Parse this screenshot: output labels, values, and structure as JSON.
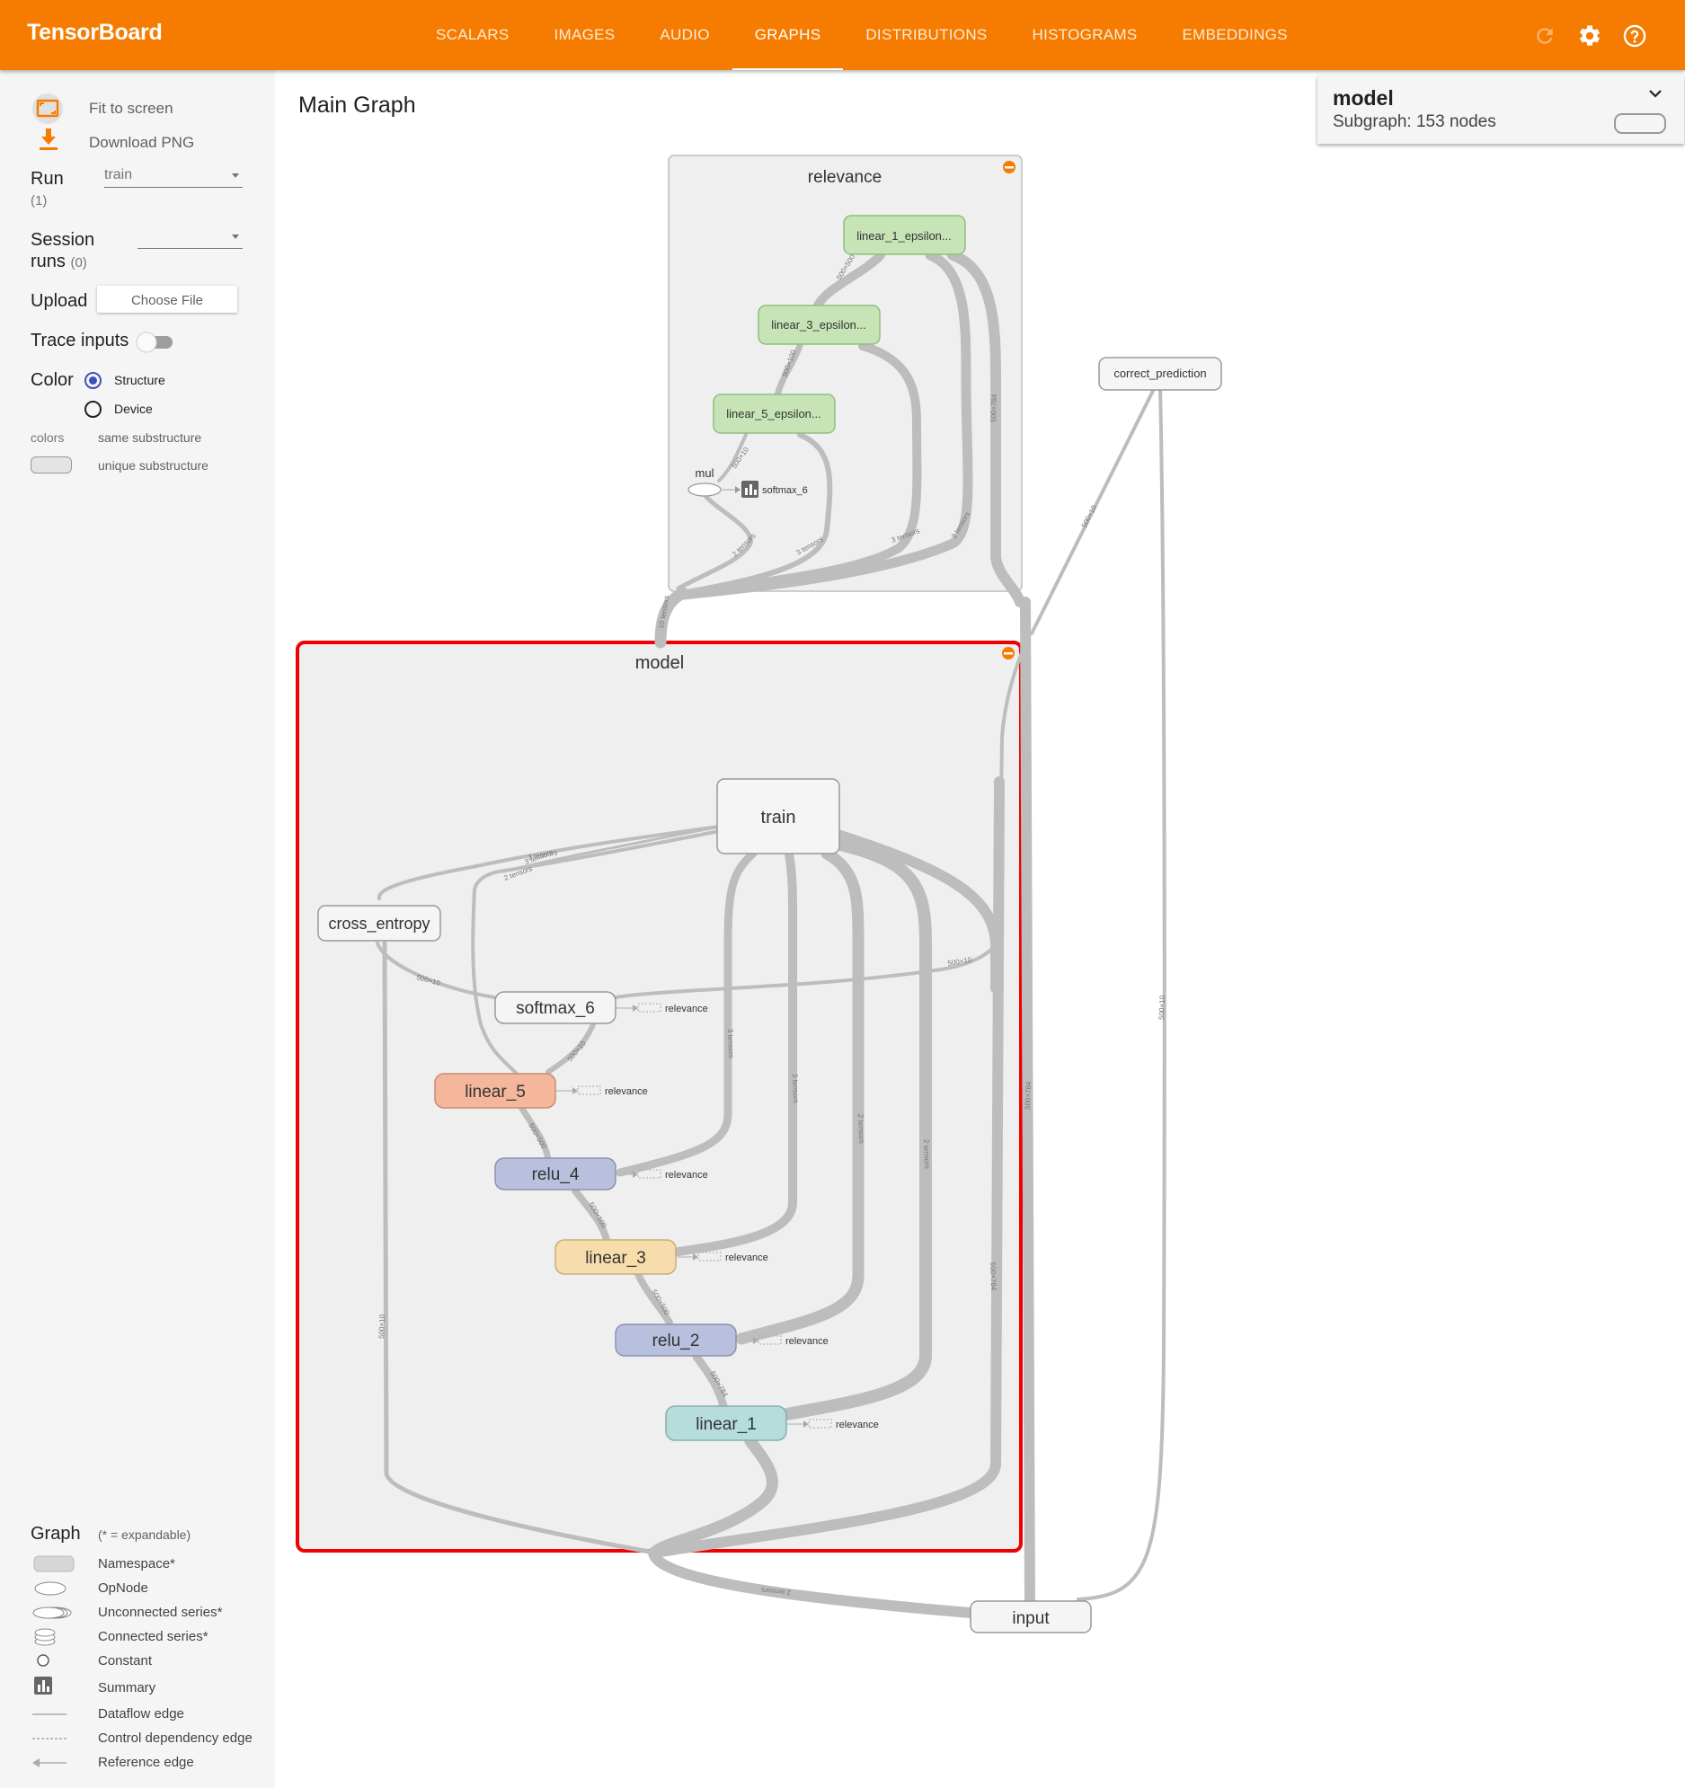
{
  "app": {
    "title": "TensorBoard"
  },
  "nav": {
    "tabs": [
      "SCALARS",
      "IMAGES",
      "AUDIO",
      "GRAPHS",
      "DISTRIBUTIONS",
      "HISTOGRAMS",
      "EMBEDDINGS"
    ],
    "active_tab": "GRAPHS"
  },
  "toolbar_icons": [
    "reload-icon",
    "gear-icon",
    "help-icon"
  ],
  "sidebar": {
    "fit_label": "Fit to screen",
    "download_label": "Download PNG",
    "run_label": "Run",
    "run_count": "(1)",
    "run_value": "train",
    "session_label_1": "Session",
    "session_label_2": "runs",
    "session_count": "(0)",
    "session_value": "",
    "upload_label": "Upload",
    "choose_file": "Choose File",
    "trace_label": "Trace inputs",
    "trace_on": false,
    "color_label": "Color",
    "color_options": [
      "Structure",
      "Device"
    ],
    "color_selected": "Structure",
    "colors_label": "colors",
    "same_sub": "same substructure",
    "unique_sub": "unique substructure",
    "graph_label": "Graph",
    "expandable_note": "(* = expandable)",
    "legend": [
      "Namespace*",
      "OpNode",
      "Unconnected series*",
      "Connected series*",
      "Constant",
      "Summary",
      "Dataflow edge",
      "Control dependency edge",
      "Reference edge"
    ]
  },
  "main": {
    "title": "Main Graph"
  },
  "info_card": {
    "name": "model",
    "subtitle": "Subgraph: 153 nodes"
  },
  "graph": {
    "relevance_group": {
      "label": "relevance"
    },
    "model_group": {
      "label": "model"
    },
    "nodes": {
      "linear_1_epsilon": "linear_1_epsilon...",
      "linear_3_epsilon": "linear_3_epsilon...",
      "linear_5_epsilon": "linear_5_epsilon...",
      "mul": "mul",
      "softmax_6_summary": "softmax_6",
      "correct_prediction": "correct_prediction",
      "train": "train",
      "cross_entropy": "cross_entropy",
      "softmax_6": "softmax_6",
      "linear_5": "linear_5",
      "relu_4": "relu_4",
      "linear_3": "linear_3",
      "relu_2": "relu_2",
      "linear_1": "linear_1",
      "input": "input"
    },
    "ref_label": "relevance",
    "edge_labels": {
      "e1": "500×500",
      "e2": "500×100",
      "e3": "500×10",
      "e4": "500×784",
      "e5": "2 tensors",
      "e6": "3 tensors",
      "e7": "3 tensors",
      "e8": "2 tensors",
      "e9": "10 tensors",
      "e10": "500×10",
      "e11": "500×10",
      "e12": "500×784",
      "e13": "3 tensors",
      "e14": "2 tensors",
      "e15": "3 tensors",
      "e16": "500×10",
      "e17": "500×10",
      "e18": "500×10",
      "e19": "500×500",
      "e20": "500×100",
      "e21": "500×500",
      "e22": "500×784",
      "e23": "3 tensors",
      "e24": "3 tensors",
      "e25": "2 tensors",
      "e26": "2 tensors",
      "e27": "500×784",
      "e28": "500×10",
      "e29": "2 tensors"
    }
  },
  "colors": {
    "brand": "#f57c00",
    "relu": "#b8c0dd",
    "linear_5": "#f4b79b",
    "linear_3": "#f7ddac",
    "linear_1": "#b6dcdc",
    "epsilon": "#c6e4b6",
    "selection": "#f00000"
  }
}
